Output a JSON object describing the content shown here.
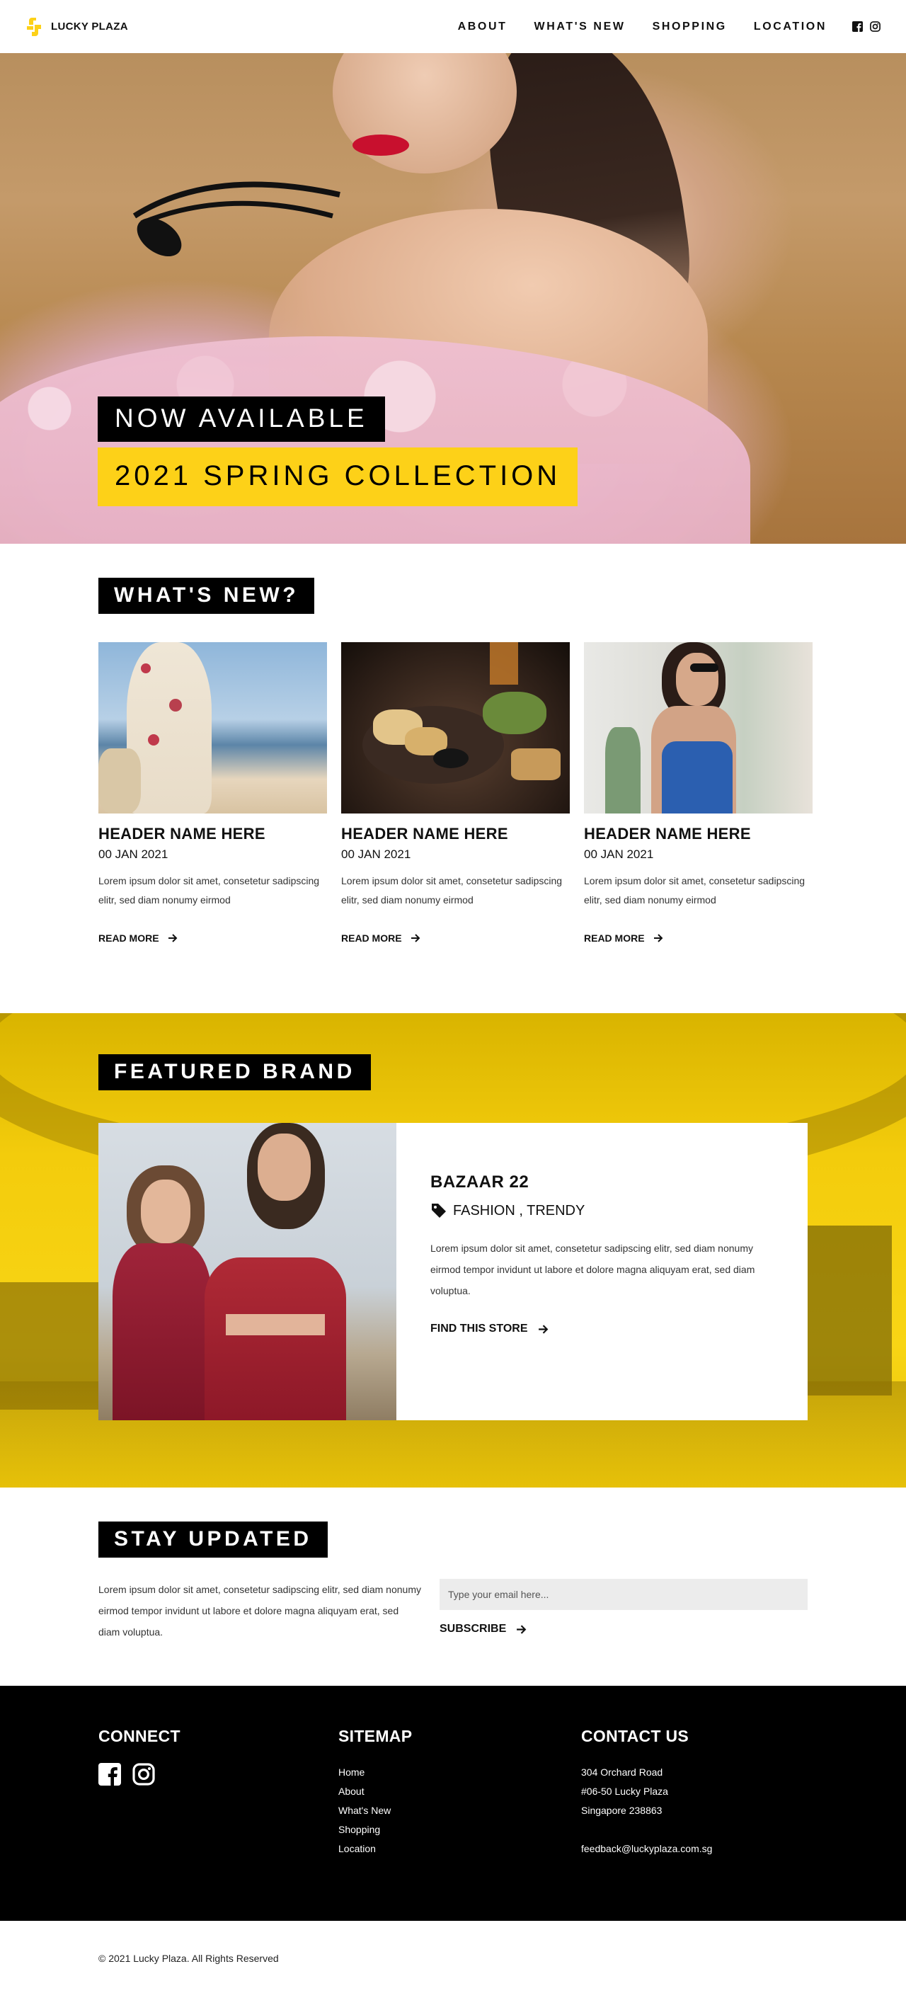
{
  "nav": {
    "brand": "LUCKY PLAZA",
    "links": [
      "ABOUT",
      "WHAT'S NEW",
      "SHOPPING",
      "LOCATION"
    ]
  },
  "hero": {
    "tag_1": "NOW AVAILABLE",
    "tag_2": "2021 SPRING COLLECTION"
  },
  "whats_new": {
    "title": "WHAT'S NEW?",
    "cards": [
      {
        "title": "HEADER NAME HERE",
        "date": "00 JAN 2021",
        "text": "Lorem ipsum dolor sit amet, consetetur sadipscing elitr, sed diam nonumy eirmod",
        "cta": "READ MORE"
      },
      {
        "title": "HEADER NAME HERE",
        "date": "00 JAN 2021",
        "text": "Lorem ipsum dolor sit amet, consetetur sadipscing elitr, sed diam nonumy eirmod",
        "cta": "READ MORE"
      },
      {
        "title": "HEADER NAME HERE",
        "date": "00 JAN 2021",
        "text": "Lorem ipsum dolor sit amet, consetetur sadipscing elitr, sed diam nonumy eirmod",
        "cta": "READ MORE"
      }
    ]
  },
  "featured": {
    "title": "FEATURED BRAND",
    "brand_name": "BAZAAR 22",
    "tags": "FASHION , TRENDY",
    "description": "Lorem ipsum dolor sit amet, consetetur sadipscing elitr, sed diam nonumy eirmod tempor invidunt ut labore et dolore magna aliquyam erat, sed diam voluptua.",
    "cta": "FIND THIS STORE"
  },
  "stay_updated": {
    "title": "STAY UPDATED",
    "text": "Lorem ipsum dolor sit amet, consetetur sadipscing elitr, sed diam nonumy eirmod tempor invidunt ut labore et dolore magna aliquyam erat, sed diam voluptua.",
    "email_placeholder": "Type your email here...",
    "cta": "SUBSCRIBE"
  },
  "footer": {
    "connect_title": "CONNECT",
    "sitemap_title": "SITEMAP",
    "sitemap_links": [
      "Home",
      "About",
      "What's New",
      "Shopping",
      "Location"
    ],
    "contact_title": "CONTACT US",
    "address": [
      "304 Orchard Road",
      "#06-50 Lucky Plaza",
      "Singapore 238863"
    ],
    "email": "feedback@luckyplaza.com.sg"
  },
  "copyright": "© 2021 Lucky Plaza. All Rights Reserved",
  "colors": {
    "accent": "#fdd118",
    "dark": "#000000"
  },
  "icons": [
    "lucky-plaza-logo-icon",
    "facebook-icon",
    "instagram-icon",
    "arrow-right-icon",
    "tag-icon"
  ]
}
